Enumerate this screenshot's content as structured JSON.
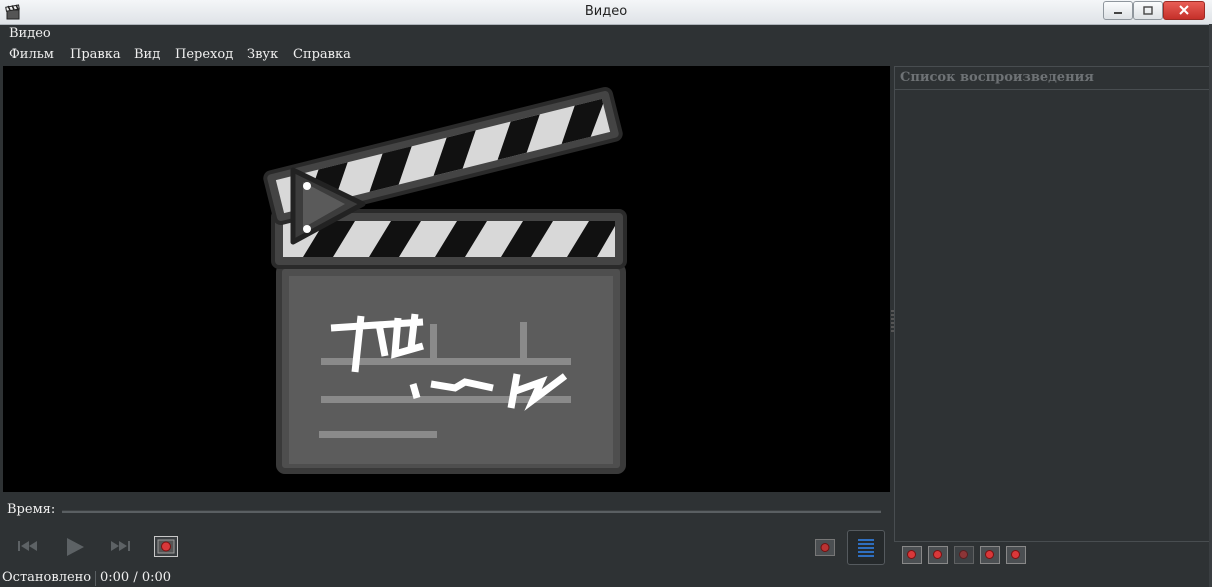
{
  "window": {
    "title": "Видео",
    "app_name": "Видео"
  },
  "menu": [
    "Фильм",
    "Правка",
    "Вид",
    "Переход",
    "Звук",
    "Справка"
  ],
  "seek": {
    "label": "Время:"
  },
  "status": {
    "state": "Остановлено",
    "time": "0:00 / 0:00"
  },
  "playlist": {
    "title": "Список воспроизведения"
  },
  "colors": {
    "record_red": "#d9383a",
    "accent_blue": "#2f6fc0"
  }
}
